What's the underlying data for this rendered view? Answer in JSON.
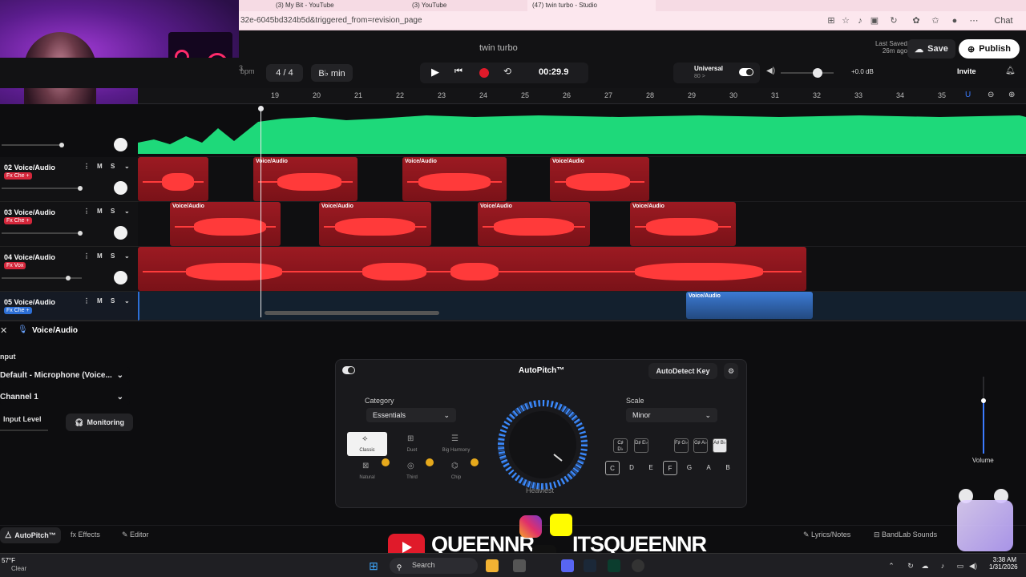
{
  "browser": {
    "url": "32e-6045bd324b5d&triggered_from=revision_page",
    "tabs": [
      "(3) My Bit - YouTube",
      "(3) YouTube",
      "(47) twin turbo - Studio"
    ]
  },
  "header": {
    "project_title": "twin turbo",
    "bpm_label": "bpm",
    "bpm_value": "3",
    "time_signature": "4 / 4",
    "key": "B♭ min",
    "time": "00:29.9",
    "preset_name": "Universal",
    "preset_value": "80 >",
    "volume_db": "+0.0 dB",
    "last_saved_label": "Last Saved",
    "last_saved_value": "26m ago",
    "save_label": "Save",
    "publish_label": "Publish",
    "invite_label": "Invite"
  },
  "ruler": [
    "19",
    "20",
    "21",
    "22",
    "23",
    "24",
    "25",
    "26",
    "27",
    "28",
    "29",
    "30",
    "31",
    "32",
    "33",
    "34",
    "35"
  ],
  "tracks": [
    {
      "name": "02 Voice/Audio",
      "fx": "Fx Che +",
      "m": "M",
      "s": "S"
    },
    {
      "name": "03 Voice/Audio",
      "fx": "Fx Che +",
      "m": "M",
      "s": "S"
    },
    {
      "name": "04 Voice/Audio",
      "fx": "Fx Vox",
      "m": "M",
      "s": "S"
    },
    {
      "name": "05 Voice/Audio",
      "fx": "Fx Che +",
      "m": "M",
      "s": "S"
    }
  ],
  "clip_label": "Voice/Audio",
  "panel": {
    "title": "Voice/Audio",
    "input_label": "nput",
    "input_device": "Default - Microphone (Voice...",
    "channel": "Channel 1",
    "input_level": "Input Level",
    "monitoring": "Monitoring",
    "volume_label": "Volume"
  },
  "autopitch": {
    "title": "AutoPitch™",
    "autodetect": "AutoDetect Key",
    "category_label": "Category",
    "category_value": "Essentials",
    "scale_label": "Scale",
    "scale_value": "Minor",
    "dial_label": "Heaviest",
    "styles": [
      "Classic",
      "Duet",
      "Big Harmony",
      "Natural",
      "Third",
      "Chip"
    ],
    "sharp_keys": [
      "C♯ D♭",
      "D♯ E♭",
      "F♯ G♭",
      "G♯ A♭",
      "A♯ B♭"
    ],
    "natural_keys": [
      "C",
      "D",
      "E",
      "F",
      "G",
      "A",
      "B"
    ]
  },
  "bottom_tabs": {
    "autopitch": "AutoPitch™",
    "effects": "Effects",
    "editor": "Editor",
    "lyrics": "Lyrics/Notes",
    "sounds": "BandLab Sounds"
  },
  "overlay": {
    "handle1": "QUEENNR",
    "handle2": "ITSQUEENNR"
  },
  "taskbar": {
    "weather_temp": "57°F",
    "weather_cond": "Clear",
    "search": "Search",
    "time": "3:38 AM",
    "date": "1/31/2026",
    "chat": "Chat"
  },
  "colors": {
    "accent_green": "#1ed97a",
    "clip_red": "#a01a22",
    "record_red": "#e01a2a",
    "selected_blue": "#2a5c8c"
  }
}
